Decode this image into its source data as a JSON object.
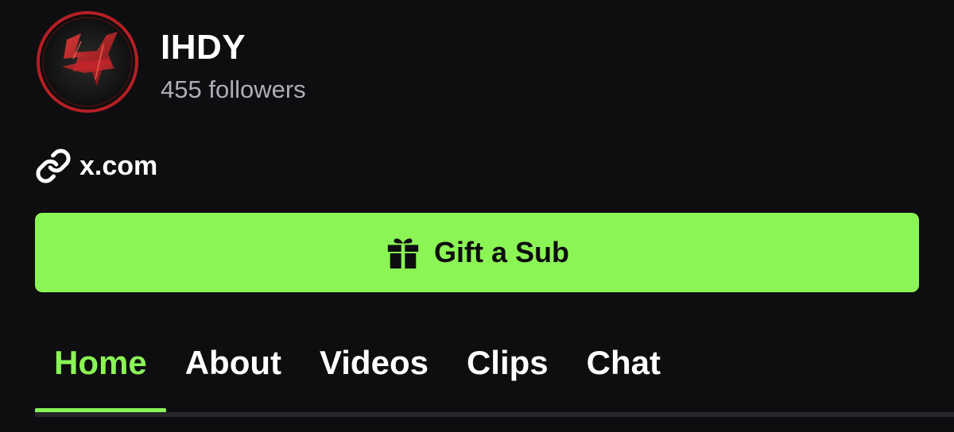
{
  "channel": {
    "name": "IHDY",
    "followers": "455 followers",
    "avatar_icon": "channel-avatar-logo"
  },
  "link": {
    "icon": "link-icon",
    "text": "x.com"
  },
  "gift_button": {
    "icon": "gift-icon",
    "label": "Gift a Sub"
  },
  "tabs": [
    {
      "label": "Home",
      "active": true
    },
    {
      "label": "About",
      "active": false
    },
    {
      "label": "Videos",
      "active": false
    },
    {
      "label": "Clips",
      "active": false
    },
    {
      "label": "Chat",
      "active": false
    }
  ],
  "colors": {
    "background": "#0e0e10",
    "accent": "#8bf556",
    "secondary_text": "#adadb8",
    "divider": "#26262c"
  }
}
